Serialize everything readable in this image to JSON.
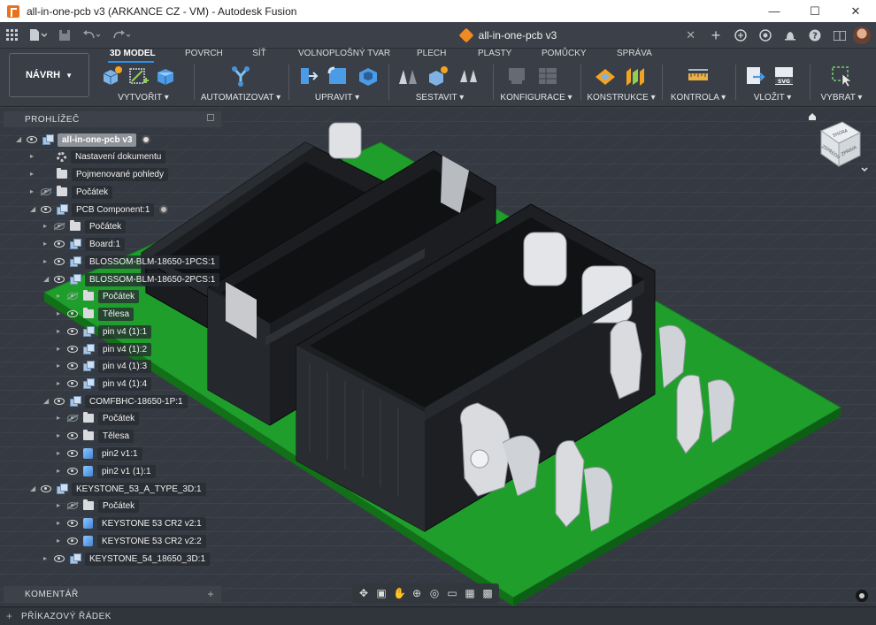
{
  "window": {
    "title": "all-in-one-pcb v3 (ARKANCE CZ - VM) - Autodesk Fusion",
    "minimize": "—",
    "maximize": "☐",
    "close": "✕"
  },
  "document_tab": {
    "name": "all-in-one-pcb v3",
    "close": "✕"
  },
  "workspace": "NÁVRH",
  "ribbon_tabs": [
    "3D MODEL",
    "POVRCH",
    "SÍŤ",
    "VOLNOPLOŠNÝ TVAR",
    "PLECH",
    "PLASTY",
    "POMŮCKY",
    "SPRÁVA"
  ],
  "ribbon_groups": [
    "VYTVOŘIT ▾",
    "AUTOMATIZOVAT ▾",
    "UPRAVIT ▾",
    "SESTAVIT ▾",
    "KONFIGURACE ▾",
    "KONSTRUKCE ▾",
    "KONTROLA ▾",
    "VLOŽIT ▾",
    "VYBRAT ▾"
  ],
  "browser": {
    "title": "PROHLÍŽEČ",
    "items": [
      {
        "label": "all-in-one-pcb v3"
      },
      {
        "label": "Nastavení dokumentu"
      },
      {
        "label": "Pojmenované pohledy"
      },
      {
        "label": "Počátek"
      },
      {
        "label": "PCB Component:1"
      },
      {
        "label": "Počátek"
      },
      {
        "label": "Board:1"
      },
      {
        "label": "BLOSSOM-BLM-18650-1PCS:1"
      },
      {
        "label": "BLOSSOM-BLM-18650-2PCS:1"
      },
      {
        "label": "Počátek"
      },
      {
        "label": "Tělesa"
      },
      {
        "label": "pin v4 (1):1"
      },
      {
        "label": "pin v4 (1):2"
      },
      {
        "label": "pin v4 (1):3"
      },
      {
        "label": "pin v4 (1):4"
      },
      {
        "label": "COMFBHC-18650-1P:1"
      },
      {
        "label": "Počátek"
      },
      {
        "label": "Tělesa"
      },
      {
        "label": "pin2 v1:1"
      },
      {
        "label": "pin2 v1 (1):1"
      },
      {
        "label": "KEYSTONE_53_A_TYPE_3D:1"
      },
      {
        "label": "Počátek"
      },
      {
        "label": "KEYSTONE 53 CR2 v2:1"
      },
      {
        "label": "KEYSTONE 53 CR2 v2:2"
      },
      {
        "label": "KEYSTONE_54_18650_3D:1"
      }
    ]
  },
  "viewcube": {
    "top": "SHORA",
    "front": "ZEPŘEDU",
    "right": "ZPRAVA"
  },
  "comments_panel": "KOMENTÁŘ",
  "command_line": "PŘÍKAZOVÝ ŘÁDEK",
  "colors": {
    "pcb": "#1f9e2c",
    "holder": "#1a1c1f",
    "clip": "#d8dadd",
    "accent": "#2f8fe8"
  }
}
